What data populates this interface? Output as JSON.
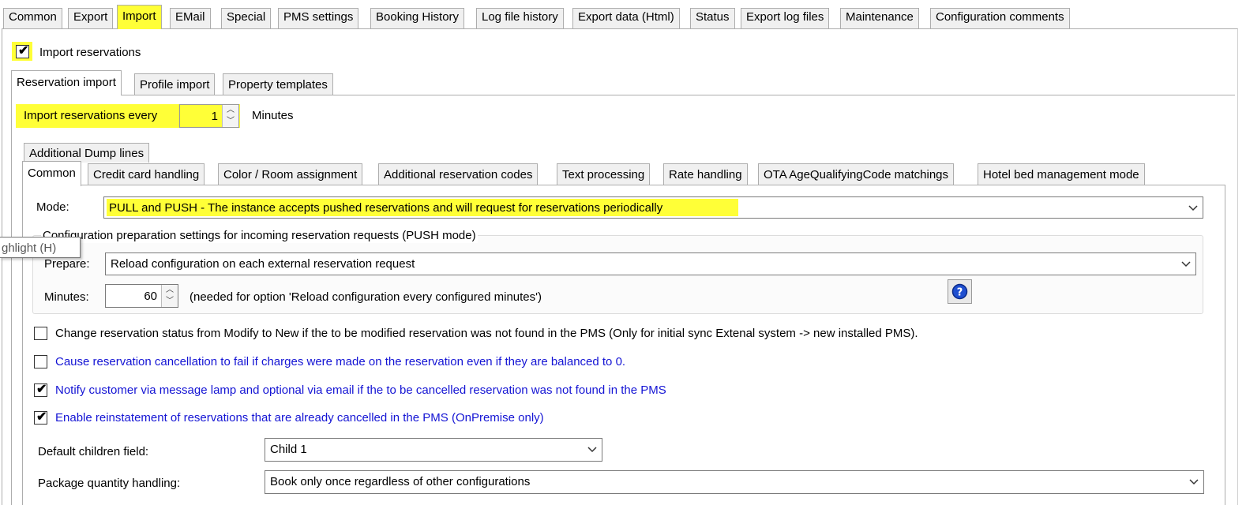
{
  "top_tabs": [
    "Common",
    "Export",
    "Import",
    "EMail",
    "Special",
    "PMS settings",
    "Booking History",
    "Log file history",
    "Export data (Html)",
    "Status",
    "Export log files",
    "Maintenance",
    "Configuration comments"
  ],
  "import_reservations": {
    "label": "Import reservations",
    "checked": true
  },
  "import_tabs": [
    "Reservation import",
    "Profile import",
    "Property templates"
  ],
  "interval": {
    "label": "Import reservations every",
    "value": "1",
    "unit": "Minutes"
  },
  "extra_tab": "Additional Dump lines",
  "inner_tabs": [
    "Common",
    "Credit card handling",
    "Color / Room assignment",
    "Additional reservation codes",
    "Text processing",
    "Rate handling",
    "OTA AgeQualifyingCode matchings",
    "Hotel bed management mode"
  ],
  "mode": {
    "label": "Mode:",
    "value": "PULL and PUSH - The instance accepts pushed reservations and will request for reservations periodically"
  },
  "group": {
    "title": "Configuration preparation settings for incoming reservation requests (PUSH mode)",
    "prepare_label": "Prepare:",
    "prepare_value": "Reload configuration on each external reservation request",
    "minutes_label": "Minutes:",
    "minutes_value": "60",
    "minutes_note": "(needed for option 'Reload configuration every configured minutes')"
  },
  "tooltip": "ghlight (H)",
  "options": [
    {
      "label": "Change reservation status from Modify to New if the to be modified reservation was not found in the PMS (Only for initial sync Extenal system -> new installed PMS).",
      "checked": false,
      "color": "#000000"
    },
    {
      "label": "Cause reservation cancellation to fail if charges were made on the reservation even if they are balanced to 0.",
      "checked": false,
      "color": "#1414d4"
    },
    {
      "label": "Notify customer via message lamp and optional via email if the to be cancelled reservation was not found in the PMS",
      "checked": true,
      "color": "#1414d4"
    },
    {
      "label": "Enable reinstatement of reservations that are already cancelled in the PMS (OnPremise only)",
      "checked": true,
      "color": "#1414d4"
    }
  ],
  "children_field": {
    "label": "Default children field:",
    "value": "Child 1"
  },
  "package_handling": {
    "label": "Package quantity handling:",
    "value": "Book only once regardless of other configurations"
  },
  "colors": {
    "highlight": "#ffff37",
    "link_blue": "#1414d4"
  }
}
